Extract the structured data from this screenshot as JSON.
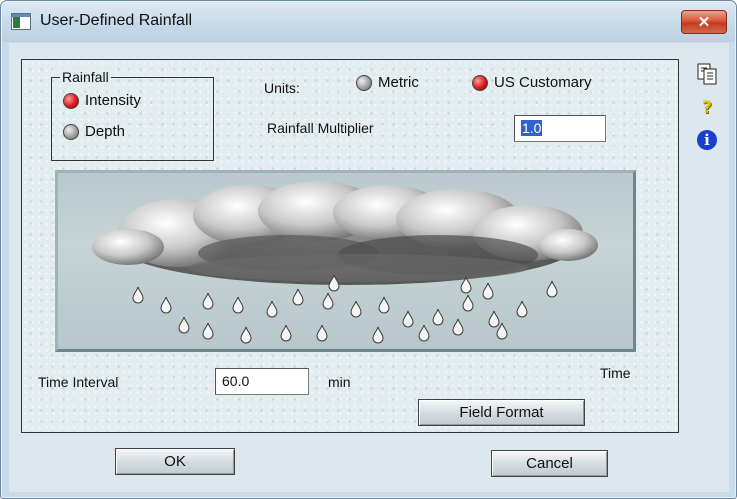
{
  "window": {
    "title": "User-Defined Rainfall",
    "close_glyph": "✕"
  },
  "rainfall_group": {
    "legend": "Rainfall",
    "options": [
      {
        "label": "Intensity",
        "checked": true
      },
      {
        "label": "Depth",
        "checked": false
      }
    ]
  },
  "units": {
    "label": "Units:",
    "options": [
      {
        "label": "Metric",
        "checked": false
      },
      {
        "label": "US Customary",
        "checked": true
      }
    ]
  },
  "multiplier": {
    "label": "Rainfall Multiplier",
    "value": "1.0"
  },
  "graphic": {
    "axis_label": "Time",
    "description_icon": "rain-cloud-image"
  },
  "time_interval": {
    "label": "Time Interval",
    "value": "60.0",
    "unit": "min"
  },
  "buttons": {
    "field_format": "Field Format",
    "ok": "OK",
    "cancel": "Cancel"
  },
  "toolbar": {
    "icons": [
      "copy-icon",
      "help-question-icon",
      "info-icon"
    ],
    "help_glyph": "?",
    "info_glyph": "i"
  },
  "colors": {
    "selection": "#2f63c9",
    "radio_checked": "#d81c1c",
    "info": "#1a3fd0",
    "help": "#e6c300"
  }
}
